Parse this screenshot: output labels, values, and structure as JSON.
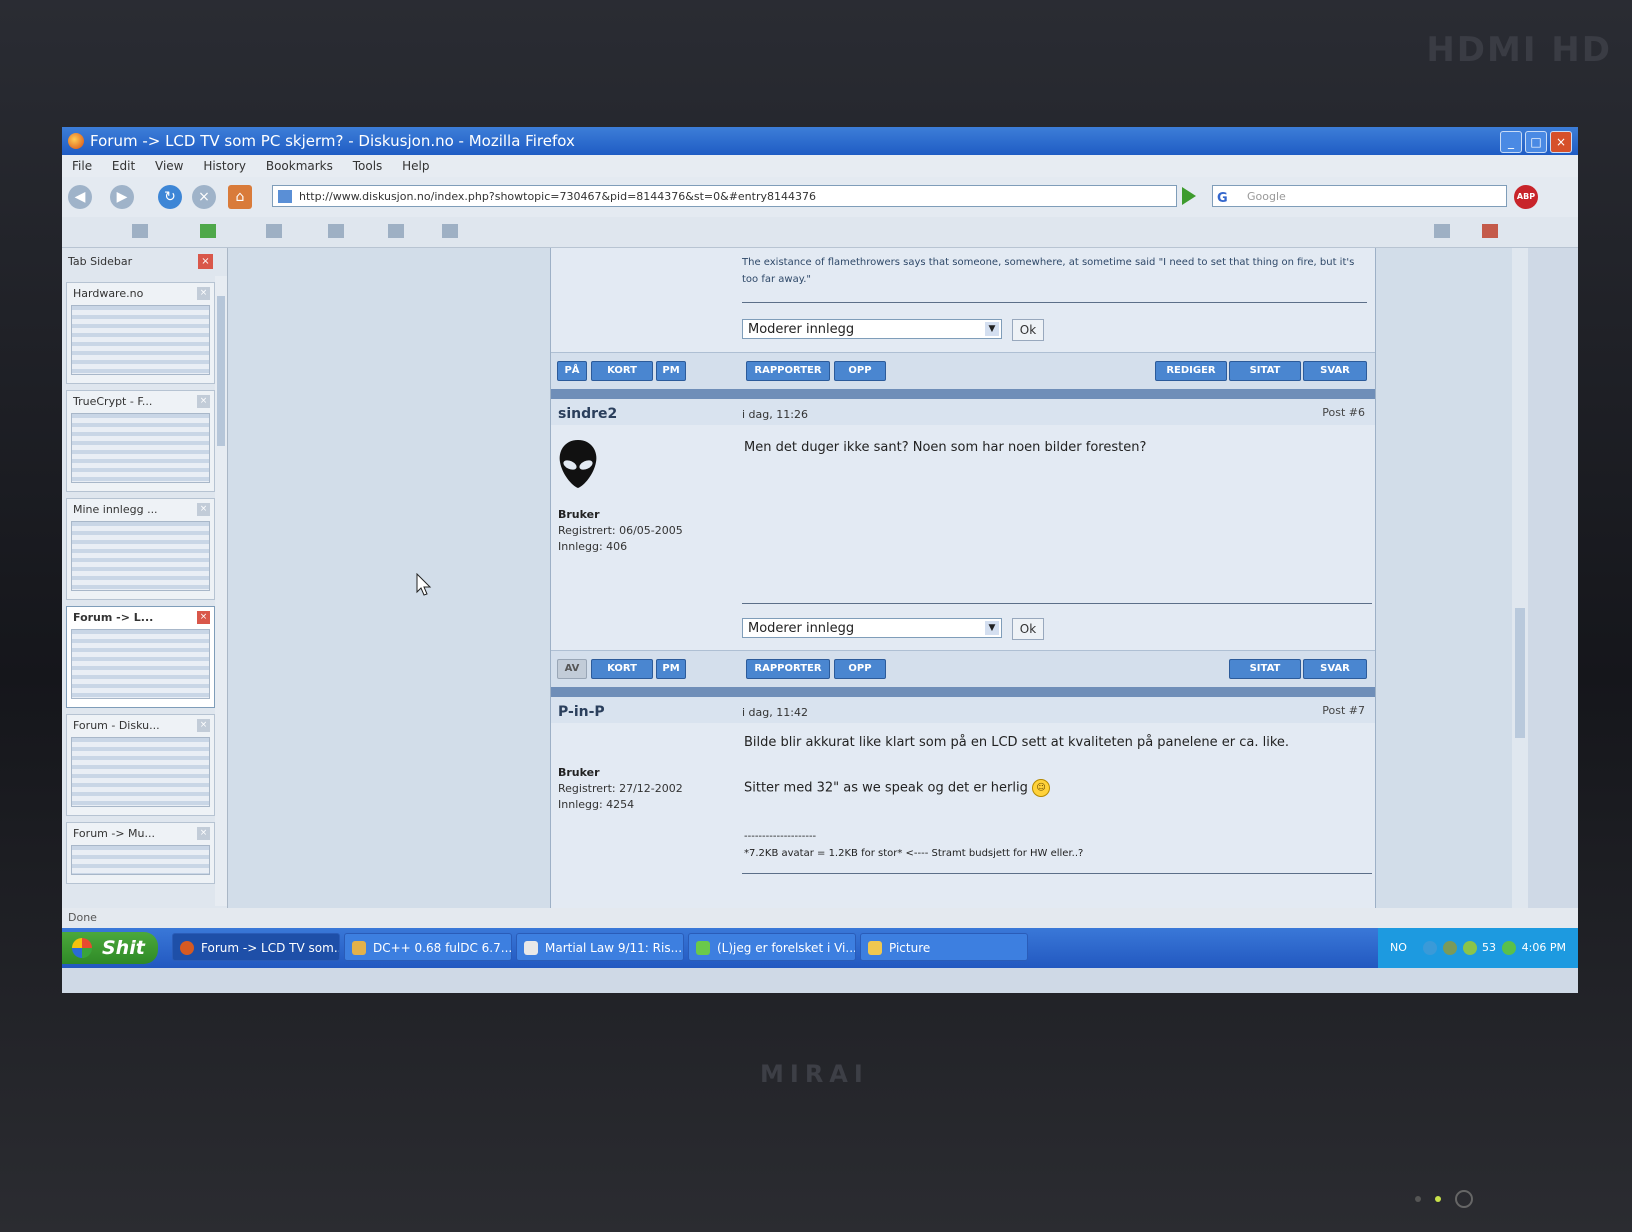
{
  "window": {
    "title": "Forum -> LCD TV som PC skjerm? - Diskusjon.no - Mozilla Firefox"
  },
  "menu": [
    "File",
    "Edit",
    "View",
    "History",
    "Bookmarks",
    "Tools",
    "Help"
  ],
  "nav": {
    "url": "http://www.diskusjon.no/index.php?showtopic=730467&pid=8144376&st=0&#entry8144376",
    "search_placeholder": "Google",
    "search_engine_letter": "G",
    "adblock_label": "ABP"
  },
  "sidebar": {
    "title": "Tab Sidebar",
    "tabs": [
      {
        "title": "Hardware.no"
      },
      {
        "title": "TrueCrypt - F..."
      },
      {
        "title": "Mine innlegg ..."
      },
      {
        "title": "Forum -> L..."
      },
      {
        "title": "Forum - Disku..."
      },
      {
        "title": "Forum -> Mu..."
      }
    ]
  },
  "signature_prev": "The existance of flamethrowers says that someone, somewhere, at sometime said \"I need to set that thing on fire, but it's too far away.\"",
  "moderate": {
    "select_value": "Moderer innlegg",
    "ok_label": "Ok"
  },
  "buttons": {
    "pa": "PÅ",
    "av": "AV",
    "kort": "KORT",
    "pm": "PM",
    "rapporter": "RAPPORTER",
    "opp": "OPP",
    "rediger": "REDIGER",
    "sitat": "SITAT",
    "svar": "SVAR"
  },
  "posts": [
    {
      "author": "sindre2",
      "date": "i dag, 11:26",
      "number": "Post #6",
      "role": "Bruker",
      "registered": "Registrert: 06/05-2005",
      "count": "Innlegg: 406",
      "text": "Men det duger ikke sant? Noen som har noen bilder foresten?"
    },
    {
      "author": "P-in-P",
      "date": "i dag, 11:42",
      "number": "Post #7",
      "role": "Bruker",
      "registered": "Registrert: 27/12-2002",
      "count": "Innlegg: 4254",
      "text1": "Bilde blir akkurat like klart som på en LCD sett at kvaliteten på panelene er ca. like.",
      "text2": "Sitter med 32\" as we speak og det er herlig",
      "sig_line": "--------------------",
      "sig_text": "*7.2KB avatar = 1.2KB for stor* <---- Stramt budsjett for HW eller..?"
    }
  ],
  "status": "Done",
  "taskbar": {
    "start": "Shit",
    "tasks": [
      {
        "label": "Forum -> LCD TV som..."
      },
      {
        "label": "DC++ 0.68 fulDC 6.7..."
      },
      {
        "label": "Martial Law 9/11: Ris..."
      },
      {
        "label": "(L)jeg er forelsket i Vi..."
      },
      {
        "label": "Picture"
      }
    ],
    "lang": "NO",
    "tray_num": "53",
    "clock": "4:06 PM"
  },
  "monitor": {
    "brand": "MIRAI",
    "badge": "HDMI HD"
  }
}
